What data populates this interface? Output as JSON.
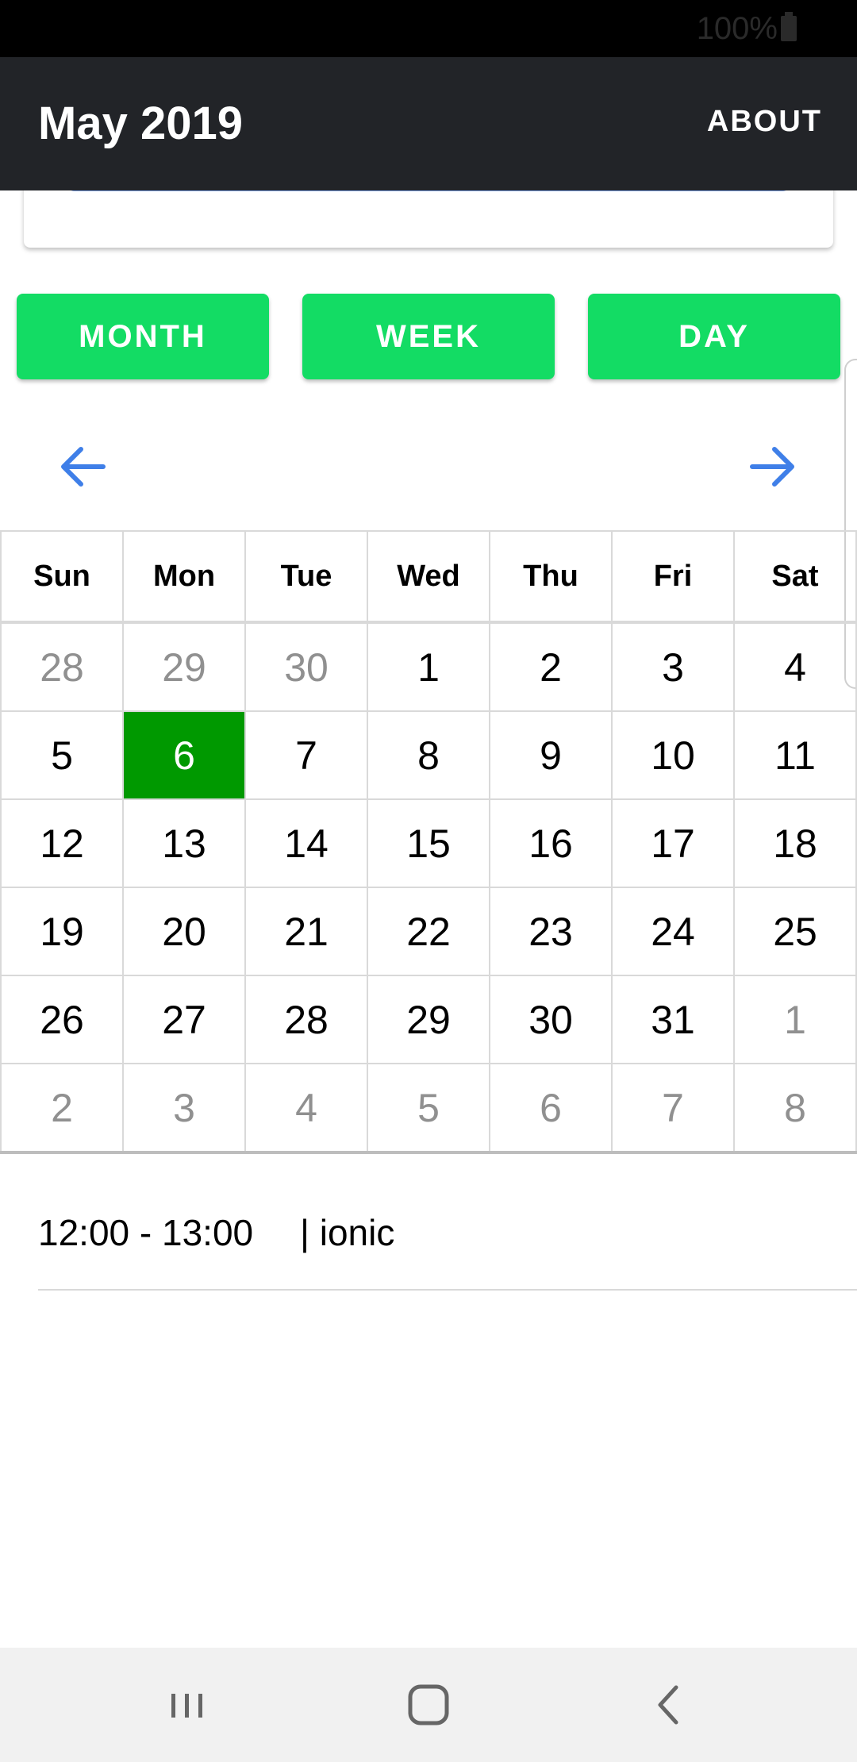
{
  "status_bar": {
    "battery": "100%"
  },
  "toolbar": {
    "title": "May 2019",
    "about_label": "ABOUT"
  },
  "view_modes": [
    "MONTH",
    "WEEK",
    "DAY"
  ],
  "weekdays": [
    "Sun",
    "Mon",
    "Tue",
    "Wed",
    "Thu",
    "Fri",
    "Sat"
  ],
  "weeks": [
    [
      {
        "d": "28",
        "other": true
      },
      {
        "d": "29",
        "other": true
      },
      {
        "d": "30",
        "other": true
      },
      {
        "d": "1"
      },
      {
        "d": "2"
      },
      {
        "d": "3"
      },
      {
        "d": "4"
      }
    ],
    [
      {
        "d": "5"
      },
      {
        "d": "6",
        "selected": true
      },
      {
        "d": "7"
      },
      {
        "d": "8"
      },
      {
        "d": "9"
      },
      {
        "d": "10"
      },
      {
        "d": "11"
      }
    ],
    [
      {
        "d": "12"
      },
      {
        "d": "13"
      },
      {
        "d": "14"
      },
      {
        "d": "15"
      },
      {
        "d": "16"
      },
      {
        "d": "17"
      },
      {
        "d": "18"
      }
    ],
    [
      {
        "d": "19"
      },
      {
        "d": "20"
      },
      {
        "d": "21"
      },
      {
        "d": "22"
      },
      {
        "d": "23"
      },
      {
        "d": "24"
      },
      {
        "d": "25"
      }
    ],
    [
      {
        "d": "26"
      },
      {
        "d": "27"
      },
      {
        "d": "28"
      },
      {
        "d": "29"
      },
      {
        "d": "30"
      },
      {
        "d": "31"
      },
      {
        "d": "1",
        "other": true
      }
    ],
    [
      {
        "d": "2",
        "other": true
      },
      {
        "d": "3",
        "other": true
      },
      {
        "d": "4",
        "other": true
      },
      {
        "d": "5",
        "other": true
      },
      {
        "d": "6",
        "other": true
      },
      {
        "d": "7",
        "other": true
      },
      {
        "d": "8",
        "other": true
      }
    ]
  ],
  "event": {
    "time": "12:00 - 13:00",
    "title": "| ionic"
  },
  "colors": {
    "accent_green": "#13dc64",
    "selected_day": "#009900",
    "arrow_blue": "#3f7fe8",
    "toolbar": "#222428"
  }
}
